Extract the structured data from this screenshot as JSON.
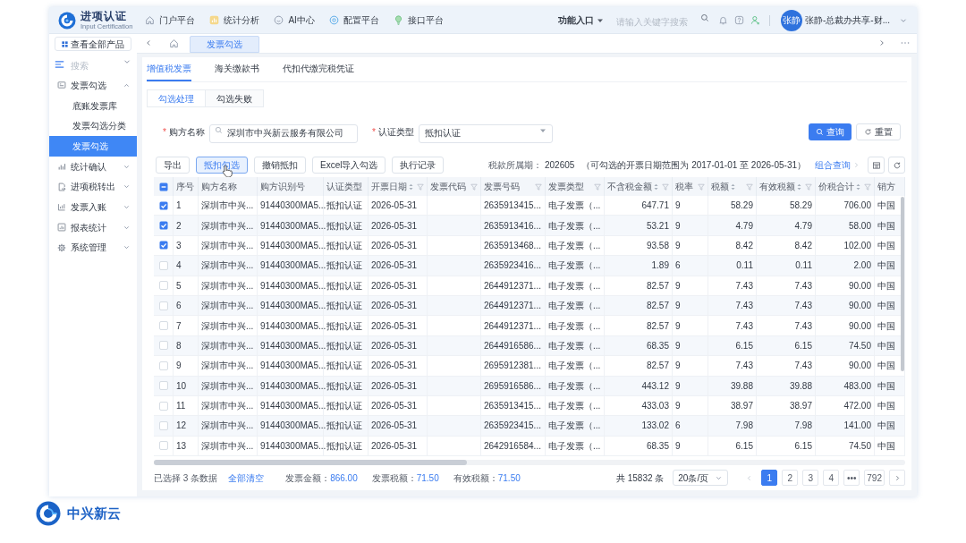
{
  "header": {
    "logo": {
      "title": "进项认证",
      "subtitle": "Input Certification"
    },
    "nav": [
      {
        "label": "门户平台"
      },
      {
        "label": "统计分析"
      },
      {
        "label": "AI中心"
      },
      {
        "label": "配置平台"
      },
      {
        "label": "接口平台"
      }
    ],
    "feature_entry": "功能入口",
    "search": {
      "placeholder": "请输入关键字搜索"
    },
    "user": {
      "avatar_text": "张静",
      "name": "张静-总裁办共享-财..."
    }
  },
  "sidebar": {
    "all_products": "查看全部产品",
    "search": {
      "placeholder": "搜索"
    },
    "items": [
      {
        "label": "发票勾选",
        "expanded": true,
        "selected": false,
        "children": [
          {
            "label": "底账发票库",
            "selected": false
          },
          {
            "label": "发票勾选分类",
            "selected": false
          },
          {
            "label": "发票勾选",
            "selected": true
          }
        ]
      },
      {
        "label": "统计确认",
        "expanded": false,
        "selected": false
      },
      {
        "label": "进项税转出",
        "expanded": false,
        "selected": false
      },
      {
        "label": "发票入账",
        "expanded": false,
        "selected": false
      },
      {
        "label": "报表统计",
        "expanded": false,
        "selected": false
      },
      {
        "label": "系统管理",
        "expanded": false,
        "selected": false
      }
    ]
  },
  "page_tabs": [
    {
      "label": "发票勾选",
      "selected": true
    }
  ],
  "category_tabs": [
    {
      "label": "增值税发票",
      "selected": true
    },
    {
      "label": "海关缴款书",
      "selected": false
    },
    {
      "label": "代扣代缴完税凭证",
      "selected": false
    }
  ],
  "sub_tabs": [
    {
      "label": "勾选处理",
      "selected": true
    },
    {
      "label": "勾选失败",
      "selected": false
    }
  ],
  "filters": [
    {
      "required_mark": "*",
      "label": "购方名称",
      "kind": "search",
      "value": "深圳市中兴新云服务有限公司"
    },
    {
      "required_mark": "*",
      "label": "认证类型",
      "kind": "select",
      "value": "抵扣认证"
    }
  ],
  "filter_buttons": [
    {
      "label": "查询",
      "kind": "primary"
    },
    {
      "label": "重置",
      "kind": "default"
    }
  ],
  "toolbar": {
    "buttons": [
      {
        "label": "导出",
        "hovered": false
      },
      {
        "label": "抵扣勾选",
        "hovered": true
      },
      {
        "label": "撤销抵扣",
        "hovered": false
      },
      {
        "label": "Excel导入勾选",
        "hovered": false
      },
      {
        "label": "执行记录",
        "hovered": false
      }
    ],
    "period": {
      "label": "税款所属期：",
      "value": "202605",
      "note": "（可勾选的开票日期范围为 2017-01-01 至 2026-05-31）"
    },
    "combo_query": "组合查询"
  },
  "table": {
    "header_checkbox": {
      "checked": false,
      "indeterminate": true
    },
    "columns": [
      {
        "label": "序号",
        "kind": "text",
        "sort": false,
        "filter": false
      },
      {
        "label": "购方名称",
        "kind": "text",
        "sort": false,
        "filter": false
      },
      {
        "label": "购方识别号",
        "kind": "text",
        "sort": false,
        "filter": false
      },
      {
        "label": "认证类型",
        "kind": "text",
        "sort": false,
        "filter": false
      },
      {
        "label": "开票日期",
        "kind": "text",
        "sort": true,
        "filter": true
      },
      {
        "label": "发票代码",
        "kind": "text",
        "sort": false,
        "filter": true
      },
      {
        "label": "发票号码",
        "kind": "text",
        "sort": false,
        "filter": true
      },
      {
        "label": "发票类型",
        "kind": "text",
        "sort": false,
        "filter": true
      },
      {
        "label": "不含税金额",
        "kind": "number",
        "sort": true,
        "filter": true
      },
      {
        "label": "税率",
        "kind": "text",
        "sort": false,
        "filter": true
      },
      {
        "label": "税额",
        "kind": "number",
        "sort": true,
        "filter": true
      },
      {
        "label": "有效税额",
        "kind": "number",
        "sort": true,
        "filter": true
      },
      {
        "label": "价税合计",
        "kind": "number",
        "sort": true,
        "filter": true
      },
      {
        "label": "销方",
        "kind": "text",
        "sort": false,
        "filter": false
      }
    ],
    "rows": [
      {
        "checked": true,
        "no": "1",
        "buyer_name": "深圳市中兴...",
        "buyer_tax_id": "91440300MA5...",
        "cert_type": "抵扣认证",
        "issue_date": "2026-05-31",
        "invoice_number": "2635913415...",
        "invoice_type": "电子发票（...",
        "amount_ex_tax": "647.71",
        "tax_rate": "9",
        "tax_amount": "58.29",
        "effective_tax": "58.29",
        "total_with_tax": "706.00",
        "seller": "中国"
      },
      {
        "checked": true,
        "no": "2",
        "buyer_name": "深圳市中兴...",
        "buyer_tax_id": "91440300MA5...",
        "cert_type": "抵扣认证",
        "issue_date": "2026-05-31",
        "invoice_number": "2635913416...",
        "invoice_type": "电子发票（...",
        "amount_ex_tax": "53.21",
        "tax_rate": "9",
        "tax_amount": "4.79",
        "effective_tax": "4.79",
        "total_with_tax": "58.00",
        "seller": "中国"
      },
      {
        "checked": true,
        "no": "3",
        "buyer_name": "深圳市中兴...",
        "buyer_tax_id": "91440300MA5...",
        "cert_type": "抵扣认证",
        "issue_date": "2026-05-31",
        "invoice_number": "2635913468...",
        "invoice_type": "电子发票（...",
        "amount_ex_tax": "93.58",
        "tax_rate": "9",
        "tax_amount": "8.42",
        "effective_tax": "8.42",
        "total_with_tax": "102.00",
        "seller": "中国"
      },
      {
        "checked": false,
        "no": "4",
        "buyer_name": "深圳市中兴...",
        "buyer_tax_id": "91440300MA5...",
        "cert_type": "抵扣认证",
        "issue_date": "2026-05-31",
        "invoice_number": "2635923416...",
        "invoice_type": "电子发票（...",
        "amount_ex_tax": "1.89",
        "tax_rate": "6",
        "tax_amount": "0.11",
        "effective_tax": "0.11",
        "total_with_tax": "2.00",
        "seller": "中国"
      },
      {
        "checked": false,
        "no": "5",
        "buyer_name": "深圳市中兴...",
        "buyer_tax_id": "91440300MA5...",
        "cert_type": "抵扣认证",
        "issue_date": "2026-05-31",
        "invoice_number": "2644912371...",
        "invoice_type": "电子发票（...",
        "amount_ex_tax": "82.57",
        "tax_rate": "9",
        "tax_amount": "7.43",
        "effective_tax": "7.43",
        "total_with_tax": "90.00",
        "seller": "中国"
      },
      {
        "checked": false,
        "no": "6",
        "buyer_name": "深圳市中兴...",
        "buyer_tax_id": "91440300MA5...",
        "cert_type": "抵扣认证",
        "issue_date": "2026-05-31",
        "invoice_number": "2644912371...",
        "invoice_type": "电子发票（...",
        "amount_ex_tax": "82.57",
        "tax_rate": "9",
        "tax_amount": "7.43",
        "effective_tax": "7.43",
        "total_with_tax": "90.00",
        "seller": "中国"
      },
      {
        "checked": false,
        "no": "7",
        "buyer_name": "深圳市中兴...",
        "buyer_tax_id": "91440300MA5...",
        "cert_type": "抵扣认证",
        "issue_date": "2026-05-31",
        "invoice_number": "2644912371...",
        "invoice_type": "电子发票（...",
        "amount_ex_tax": "82.57",
        "tax_rate": "9",
        "tax_amount": "7.43",
        "effective_tax": "7.43",
        "total_with_tax": "90.00",
        "seller": "中国"
      },
      {
        "checked": false,
        "no": "8",
        "buyer_name": "深圳市中兴...",
        "buyer_tax_id": "91440300MA5...",
        "cert_type": "抵扣认证",
        "issue_date": "2026-05-31",
        "invoice_number": "2644916586...",
        "invoice_type": "电子发票（...",
        "amount_ex_tax": "68.35",
        "tax_rate": "9",
        "tax_amount": "6.15",
        "effective_tax": "6.15",
        "total_with_tax": "74.50",
        "seller": "中国"
      },
      {
        "checked": false,
        "no": "9",
        "buyer_name": "深圳市中兴...",
        "buyer_tax_id": "91440300MA5...",
        "cert_type": "抵扣认证",
        "issue_date": "2026-05-31",
        "invoice_number": "2695912381...",
        "invoice_type": "电子发票（...",
        "amount_ex_tax": "82.57",
        "tax_rate": "9",
        "tax_amount": "7.43",
        "effective_tax": "7.43",
        "total_with_tax": "90.00",
        "seller": "中国"
      },
      {
        "checked": false,
        "no": "10",
        "buyer_name": "深圳市中兴...",
        "buyer_tax_id": "91440300MA5...",
        "cert_type": "抵扣认证",
        "issue_date": "2026-05-31",
        "invoice_number": "2695916586...",
        "invoice_type": "电子发票（...",
        "amount_ex_tax": "443.12",
        "tax_rate": "9",
        "tax_amount": "39.88",
        "effective_tax": "39.88",
        "total_with_tax": "483.00",
        "seller": "中国"
      },
      {
        "checked": false,
        "no": "11",
        "buyer_name": "深圳市中兴...",
        "buyer_tax_id": "91440300MA5...",
        "cert_type": "抵扣认证",
        "issue_date": "2026-05-31",
        "invoice_number": "2635913415...",
        "invoice_type": "电子发票（...",
        "amount_ex_tax": "433.03",
        "tax_rate": "9",
        "tax_amount": "38.97",
        "effective_tax": "38.97",
        "total_with_tax": "472.00",
        "seller": "中国"
      },
      {
        "checked": false,
        "no": "12",
        "buyer_name": "深圳市中兴...",
        "buyer_tax_id": "91440300MA5...",
        "cert_type": "抵扣认证",
        "issue_date": "2026-05-31",
        "invoice_number": "2635923415...",
        "invoice_type": "电子发票（...",
        "amount_ex_tax": "133.02",
        "tax_rate": "6",
        "tax_amount": "7.98",
        "effective_tax": "7.98",
        "total_with_tax": "141.00",
        "seller": "中国"
      },
      {
        "checked": false,
        "no": "13",
        "buyer_name": "深圳市中兴...",
        "buyer_tax_id": "91440300MA5...",
        "cert_type": "抵扣认证",
        "issue_date": "2026-05-31",
        "invoice_number": "2642916584...",
        "invoice_type": "电子发票（...",
        "amount_ex_tax": "68.35",
        "tax_rate": "9",
        "tax_amount": "6.15",
        "effective_tax": "6.15",
        "total_with_tax": "74.50",
        "seller": "中国"
      }
    ]
  },
  "footer": {
    "selection": "已选择 3 条数据",
    "clear_all": "全部清空",
    "totals": [
      {
        "label": "发票金额：",
        "value": "866.00"
      },
      {
        "label": "发票税额：",
        "value": "71.50"
      },
      {
        "label": "有效税额：",
        "value": "71.50"
      }
    ],
    "total_count": "共 15832 条",
    "page_size": "20条/页",
    "pagination": {
      "prev_disabled": true,
      "next_disabled": false,
      "pages": [
        {
          "label": "1",
          "selected": true
        },
        {
          "label": "2",
          "selected": false
        },
        {
          "label": "3",
          "selected": false
        },
        {
          "label": "4",
          "selected": false
        },
        {
          "label": "•••",
          "selected": false
        },
        {
          "label": "792",
          "selected": false
        }
      ]
    }
  },
  "brand": {
    "name": "中兴新云"
  }
}
